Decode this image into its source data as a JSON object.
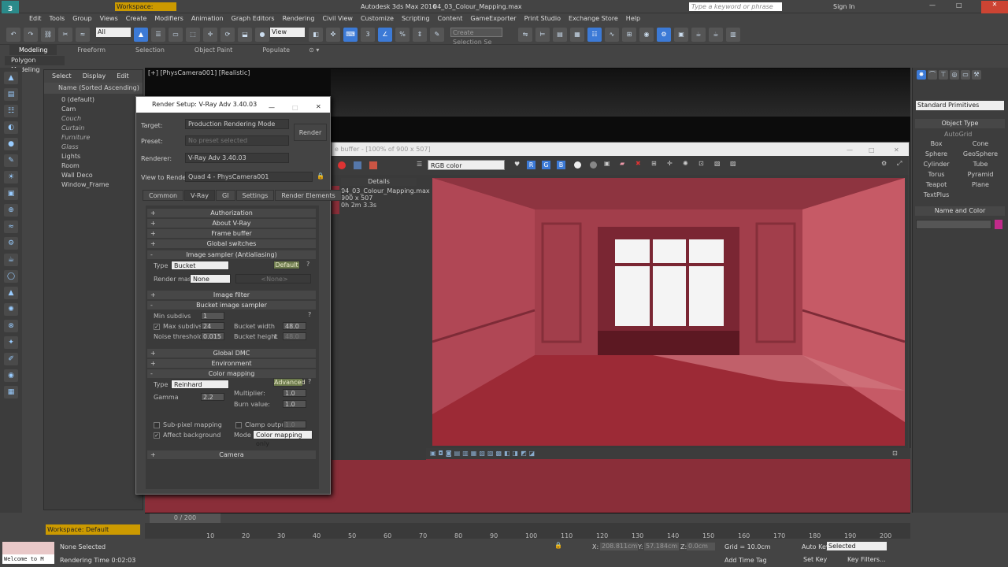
{
  "window": {
    "app_title": "Autodesk 3ds Max 2016",
    "file_name": "04_03_Colour_Mapping.max",
    "workspace": "Workspace: Default",
    "search_placeholder": "Type a keyword or phrase",
    "sign_in": "Sign In"
  },
  "menu": [
    "Edit",
    "Tools",
    "Group",
    "Views",
    "Create",
    "Modifiers",
    "Animation",
    "Graph Editors",
    "Rendering",
    "Civil View",
    "Customize",
    "Scripting",
    "Content",
    "GameExporter",
    "Print Studio",
    "Exchange Store",
    "Help"
  ],
  "toolbar": {
    "filter": "All",
    "view": "View",
    "selection_set": "Create Selection Se"
  },
  "ribbon": {
    "tabs": [
      "Modeling",
      "Freeform",
      "Selection",
      "Object Paint",
      "Populate"
    ],
    "sub": "Polygon Modeling"
  },
  "scene_explorer": {
    "tabs": [
      "Select",
      "Display",
      "Edit"
    ],
    "header": "Name (Sorted Ascending)",
    "items": [
      "0 (default)",
      "Cam",
      "Couch",
      "Curtain",
      "Furniture",
      "Glass",
      "Lights",
      "Room",
      "Wall Deco",
      "Window_Frame"
    ]
  },
  "viewport": {
    "label": "[+] [PhysCamera001] [Realistic]"
  },
  "frame_buffer": {
    "title": "e buffer - [100% of 900 x 507]",
    "channel": "RGB color",
    "details_header": "Details",
    "details": [
      "04_03_Colour_Mapping.max",
      "900 x 507",
      "0h 2m 3.3s"
    ]
  },
  "render_setup": {
    "title": "Render Setup: V-Ray Adv 3.40.03",
    "target_label": "Target:",
    "target": "Production Rendering Mode",
    "preset_label": "Preset:",
    "preset": "No preset selected",
    "renderer_label": "Renderer:",
    "renderer": "V-Ray Adv 3.40.03",
    "view_label": "View to Render:",
    "view": "Quad 4 - PhysCamera001",
    "render_button": "Render",
    "tabs": [
      "Common",
      "V-Ray",
      "GI",
      "Settings",
      "Render Elements"
    ],
    "rollouts": {
      "authorization": "Authorization",
      "about": "About V-Ray",
      "frame_buffer": "Frame buffer",
      "global_switches": "Global switches",
      "image_sampler": "Image sampler (Antialiasing)",
      "image_filter": "Image filter",
      "bucket_sampler": "Bucket image sampler",
      "global_dmc": "Global DMC",
      "environment": "Environment",
      "color_mapping": "Color mapping",
      "camera": "Camera"
    },
    "image_sampler": {
      "type_label": "Type",
      "type": "Bucket",
      "default_btn": "Default",
      "render_mask_label": "Render mask",
      "render_mask": "None",
      "mask_value": "<None>"
    },
    "bucket": {
      "min_subdivs_label": "Min subdivs",
      "min_subdivs": "1",
      "max_subdivs_label": "Max subdivs",
      "max_subdivs": "24",
      "noise_label": "Noise threshold",
      "noise": "0.015",
      "width_label": "Bucket width",
      "width": "48.0",
      "height_label": "Bucket height",
      "height_l": "L",
      "height": "48.0"
    },
    "color_mapping": {
      "type_label": "Type",
      "type": "Reinhard",
      "advanced_btn": "Advanced",
      "multiplier_label": "Multiplier:",
      "multiplier": "1.0",
      "gamma_label": "Gamma",
      "gamma": "2.2",
      "burn_label": "Burn value:",
      "burn": "1.0",
      "subpixel_label": "Sub-pixel mapping",
      "clamp_label": "Clamp output",
      "clamp_value": "1.0",
      "affect_bg_label": "Affect background",
      "mode_label": "Mode",
      "mode": "Color mapping only"
    }
  },
  "command_panel": {
    "dropdown": "Standard Primitives",
    "object_type": "Object Type",
    "autogrid": "AutoGrid",
    "objects": [
      "Box",
      "Cone",
      "Sphere",
      "GeoSphere",
      "Cylinder",
      "Tube",
      "Torus",
      "Pyramid",
      "Teapot",
      "Plane",
      "TextPlus"
    ],
    "name_color": "Name and Color"
  },
  "timeline": {
    "frame": "0 / 200",
    "ticks": [
      "10",
      "20",
      "30",
      "40",
      "50",
      "60",
      "70",
      "80",
      "90",
      "100",
      "110",
      "120",
      "130",
      "140",
      "150",
      "160",
      "170",
      "180",
      "190",
      "200"
    ]
  },
  "status": {
    "workspace": "Workspace: Default",
    "maxscript": "Welcome to M",
    "selected": "None Selected",
    "render_time": "Rendering Time  0:02:03",
    "x": "208.811cm",
    "y": "57.184cm",
    "z": "0.0cm",
    "grid": "Grid = 10.0cm",
    "add_time_tag": "Add Time Tag",
    "auto_key": "Auto Key",
    "auto_key_sel": "Selected",
    "set_key": "Set Key",
    "key_filters": "Key Filters..."
  },
  "colors": {
    "accent": "#3c7ad6",
    "render_room": "#b44a58",
    "green_button": "#6c7a4c"
  }
}
